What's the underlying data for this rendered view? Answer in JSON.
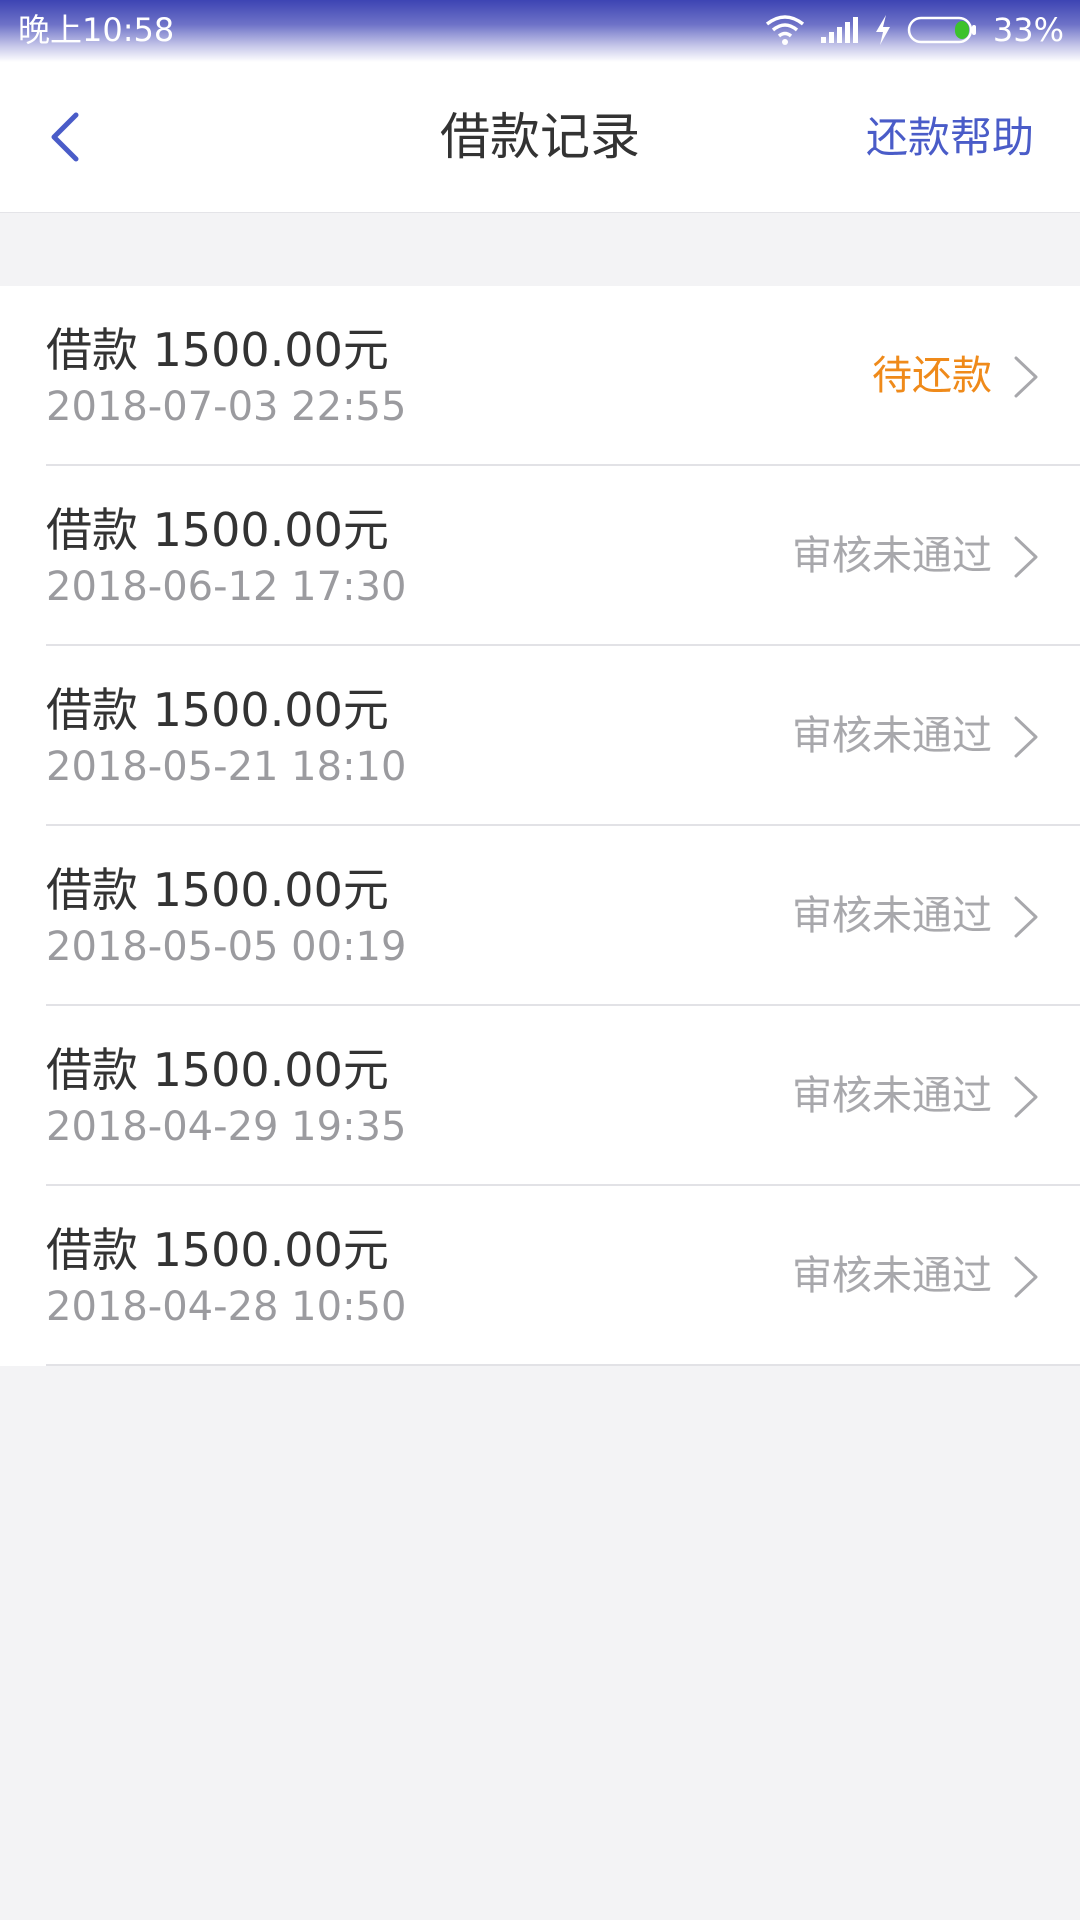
{
  "status_bar": {
    "time": "晚上10:58",
    "battery_percent": "33%",
    "icons": [
      "wifi-icon",
      "signal-icon",
      "charging-icon",
      "battery-icon"
    ],
    "battery_fill_color": "#3cc22c"
  },
  "header": {
    "title": "借款记录",
    "help_label": "还款帮助",
    "back_icon": "chevron-left-icon",
    "accent_color": "#4a5cc8"
  },
  "records": [
    {
      "amount": "借款 1500.00元",
      "date": "2018-07-03 22:55",
      "status": "待还款",
      "status_type": "pending"
    },
    {
      "amount": "借款 1500.00元",
      "date": "2018-06-12 17:30",
      "status": "审核未通过",
      "status_type": "rejected"
    },
    {
      "amount": "借款 1500.00元",
      "date": "2018-05-21 18:10",
      "status": "审核未通过",
      "status_type": "rejected"
    },
    {
      "amount": "借款 1500.00元",
      "date": "2018-05-05 00:19",
      "status": "审核未通过",
      "status_type": "rejected"
    },
    {
      "amount": "借款 1500.00元",
      "date": "2018-04-29 19:35",
      "status": "审核未通过",
      "status_type": "rejected"
    },
    {
      "amount": "借款 1500.00元",
      "date": "2018-04-28 10:50",
      "status": "审核未通过",
      "status_type": "rejected"
    }
  ],
  "colors": {
    "pending": "#ef8a1a",
    "rejected": "#a8a8ac",
    "background": "#f3f3f5"
  }
}
